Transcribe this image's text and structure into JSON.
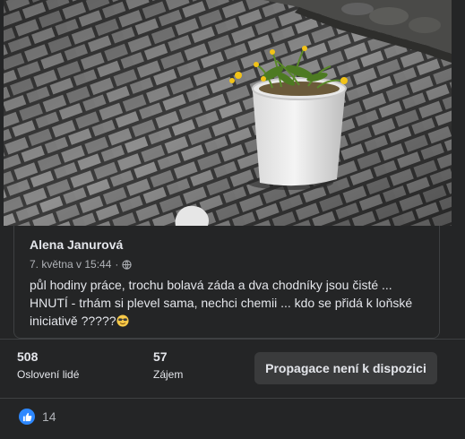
{
  "post": {
    "author": "Alena Janurová",
    "date": "7. května v 15:44",
    "separator": "·",
    "text": "půl hodiny práce, trochu bolavá záda a dva chodníky jsou čisté ... HNUTÍ - trhám si plevel sama, nechci chemii ... kdo se přidá k loňské iniciativě ?????",
    "privacy_icon": "globe-icon",
    "emoji_icon": "smiling-face-with-sunglasses-emoji"
  },
  "insights": {
    "reached": {
      "value": "508",
      "label": "Oslovení lidé"
    },
    "engagement": {
      "value": "57",
      "label": "Zájem"
    },
    "promote_button": "Propagace není k dispozici"
  },
  "reactions": {
    "icon": "like-icon",
    "count": "14"
  },
  "colors": {
    "background": "#242526",
    "text_primary": "#e4e6eb",
    "text_secondary": "#b0b3b8",
    "button_bg": "#3a3b3c",
    "like_blue": "#2d88ff",
    "divider": "#3e4042"
  }
}
